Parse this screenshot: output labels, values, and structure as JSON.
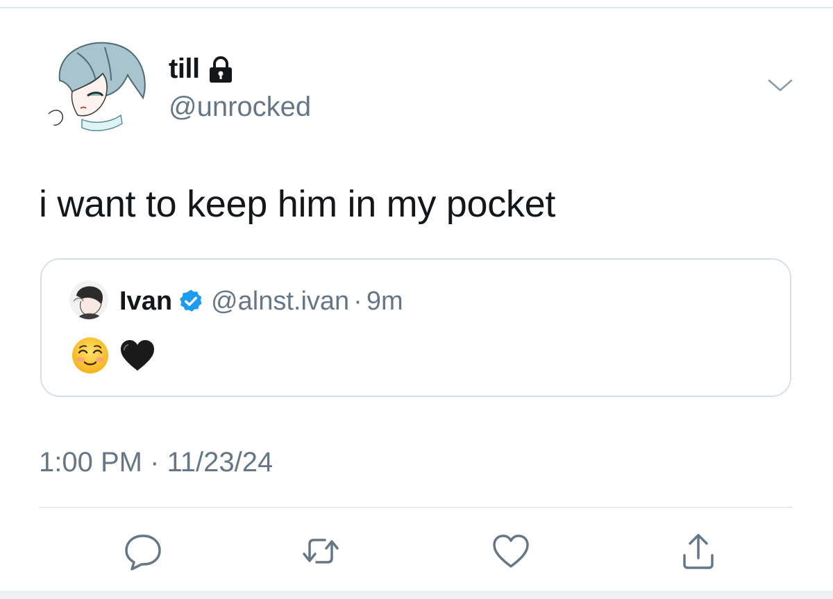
{
  "author": {
    "display_name": "till",
    "handle": "@unrocked",
    "avatar_icon": "anime-avatar-blue-hair",
    "protected_icon": "lock-icon"
  },
  "tweet": {
    "text": "i want to keep him in my pocket",
    "timestamp": "1:00 PM · 11/23/24"
  },
  "quoted_tweet": {
    "display_name": "Ivan",
    "verified_icon": "verified-badge-icon",
    "handle": "@alnst.ivan",
    "separator": "·",
    "age": "9m",
    "emojis": [
      "☺️",
      "🖤"
    ]
  },
  "actions": [
    {
      "name": "reply",
      "icon": "speech-bubble-icon"
    },
    {
      "name": "retweet",
      "icon": "retweet-icon"
    },
    {
      "name": "like",
      "icon": "heart-icon"
    },
    {
      "name": "share",
      "icon": "share-icon"
    }
  ],
  "colors": {
    "text_primary": "#14171a",
    "text_secondary": "#657786",
    "border": "#d8e0e6",
    "verified_blue": "#1d9bf0"
  }
}
